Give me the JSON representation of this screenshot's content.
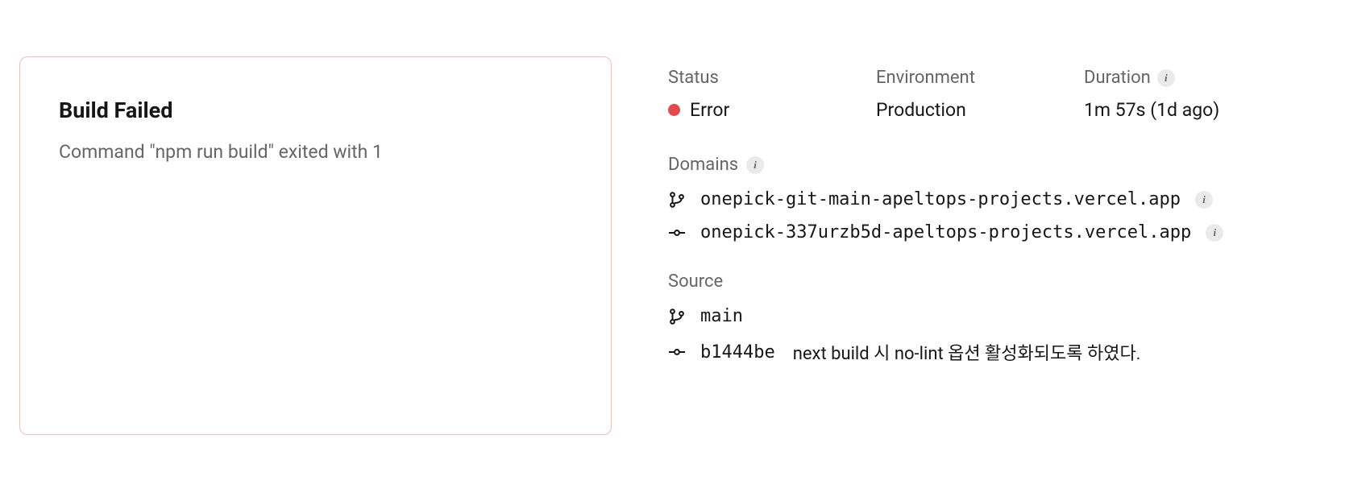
{
  "build": {
    "title": "Build Failed",
    "message": "Command \"npm run build\" exited with 1"
  },
  "status": {
    "label": "Status",
    "value": "Error",
    "color": "#e5484d"
  },
  "environment": {
    "label": "Environment",
    "value": "Production"
  },
  "duration": {
    "label": "Duration",
    "value": "1m 57s (1d ago)"
  },
  "domains": {
    "label": "Domains",
    "items": [
      {
        "type": "branch",
        "url": "onepick-git-main-apeltops-projects.vercel.app"
      },
      {
        "type": "commit",
        "url": "onepick-337urzb5d-apeltops-projects.vercel.app"
      }
    ]
  },
  "source": {
    "label": "Source",
    "branch": "main",
    "commit": "b1444be",
    "message": "next build 시 no-lint 옵션 활성화되도록 하였다."
  }
}
